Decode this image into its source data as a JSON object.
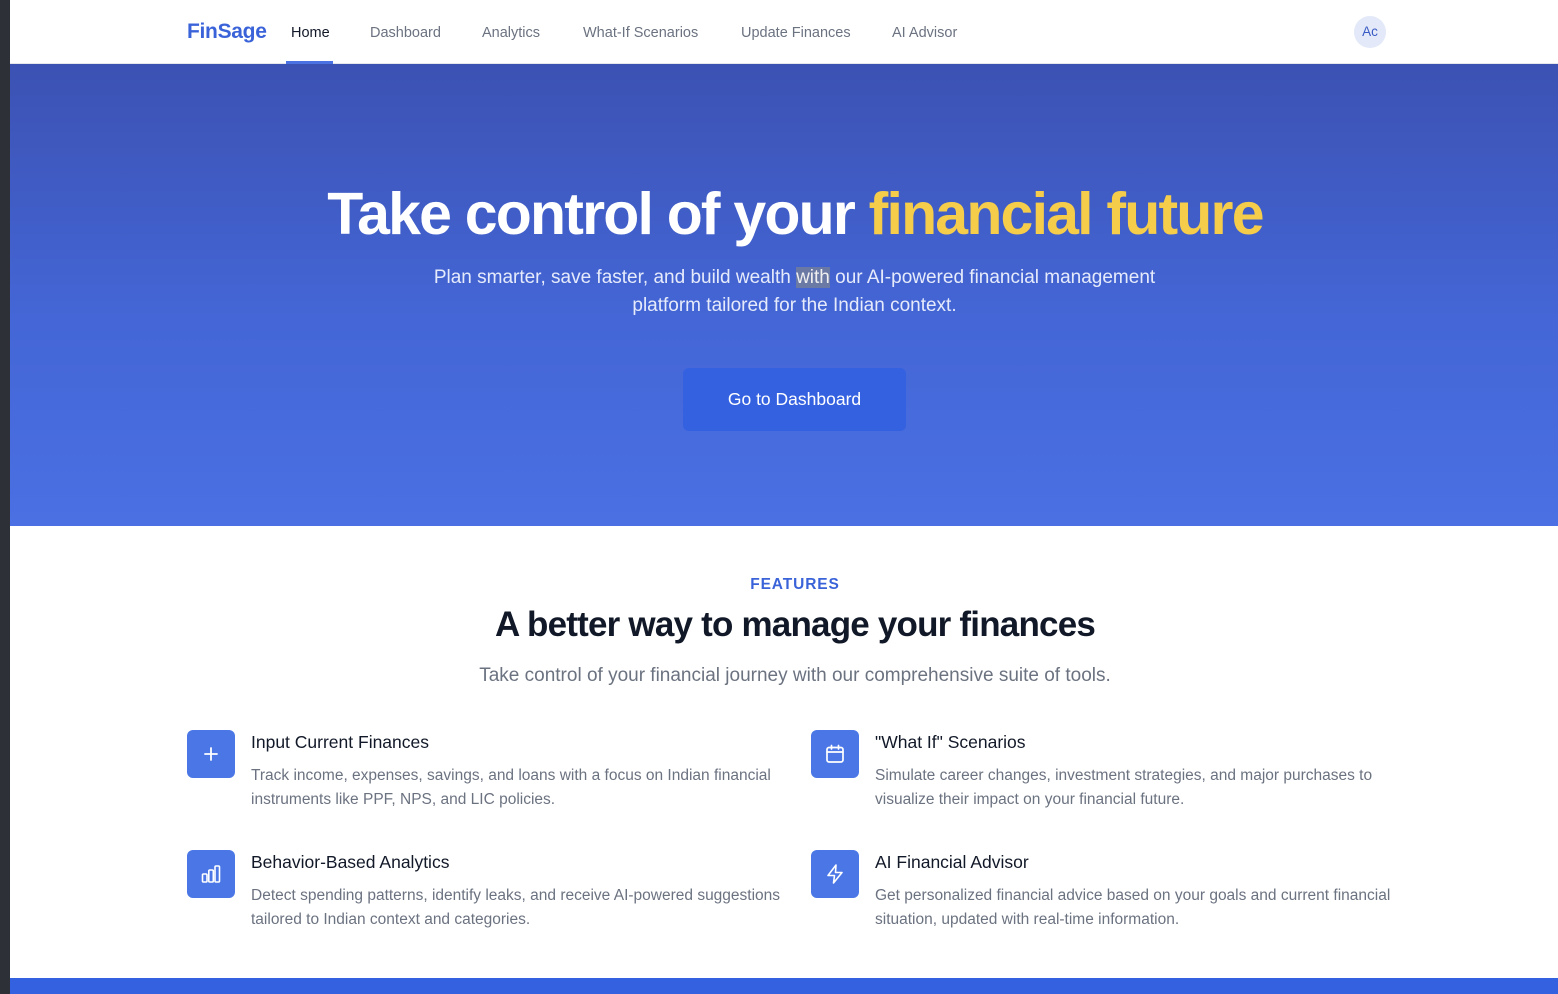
{
  "nav": {
    "logo": "FinSage",
    "links": [
      {
        "label": "Home",
        "active": true
      },
      {
        "label": "Dashboard"
      },
      {
        "label": "Analytics"
      },
      {
        "label": "What-If Scenarios"
      },
      {
        "label": "Update Finances"
      },
      {
        "label": "AI Advisor"
      }
    ],
    "avatar": "Ac"
  },
  "hero": {
    "title_main": "Take control of your ",
    "title_accent": "financial future",
    "subtitle_before": "Plan smarter, save faster, and build wealth ",
    "subtitle_highlight": "with",
    "subtitle_after": " our AI-powered financial management platform tailored for the Indian context.",
    "cta": "Go to Dashboard"
  },
  "features": {
    "label": "FEATURES",
    "title": "A better way to manage your finances",
    "subtitle": "Take control of your financial journey with our comprehensive suite of tools.",
    "items": [
      {
        "icon": "plus-icon",
        "title": "Input Current Finances",
        "desc": "Track income, expenses, savings, and loans with a focus on Indian financial instruments like PPF, NPS, and LIC policies."
      },
      {
        "icon": "calendar-icon",
        "title": "\"What If\" Scenarios",
        "desc": "Simulate career changes, investment strategies, and major purchases to visualize their impact on your financial future."
      },
      {
        "icon": "bar-chart-icon",
        "title": "Behavior-Based Analytics",
        "desc": "Detect spending patterns, identify leaks, and receive AI-powered suggestions tailored to Indian context and categories."
      },
      {
        "icon": "lightning-icon",
        "title": "AI Financial Advisor",
        "desc": "Get personalized financial advice based on your goals and current financial situation, updated with real-time information."
      }
    ]
  },
  "colors": {
    "brand": "#3b63d9",
    "hero_accent": "#f5cd4b",
    "cta_bg": "#3461e0",
    "icon_bg": "#4a76e6"
  }
}
